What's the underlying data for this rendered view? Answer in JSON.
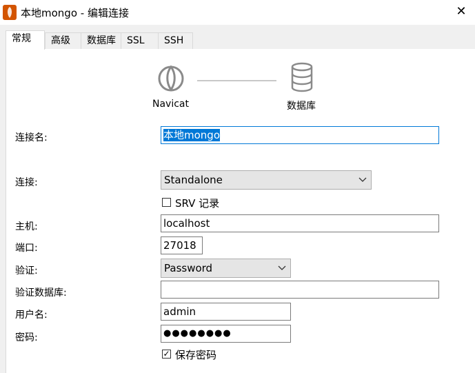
{
  "window": {
    "title": "本地mongo - 编辑连接",
    "close_glyph": "✕"
  },
  "tabs": [
    {
      "label": "常规"
    },
    {
      "label": "高级"
    },
    {
      "label": "数据库"
    },
    {
      "label": "SSL"
    },
    {
      "label": "SSH"
    }
  ],
  "diagram": {
    "left_label": "Navicat",
    "right_label": "数据库"
  },
  "form": {
    "conn_name": {
      "label": "连接名:",
      "value": "本地mongo"
    },
    "connection": {
      "label": "连接:",
      "value": "Standalone"
    },
    "srv": {
      "label": "SRV 记录",
      "checked": false
    },
    "host": {
      "label": "主机:",
      "value": "localhost"
    },
    "port": {
      "label": "端口:",
      "value": "27018"
    },
    "auth": {
      "label": "验证:",
      "value": "Password"
    },
    "auth_db": {
      "label": "验证数据库:",
      "value": ""
    },
    "username": {
      "label": "用户名:",
      "value": "admin"
    },
    "password": {
      "label": "密码:",
      "value": "●●●●●●●●"
    },
    "save_password": {
      "label": "保存密码",
      "checked": true,
      "glyph": "✓"
    }
  },
  "icons": {
    "app": "navicat-app-icon",
    "navicat": "navicat-seal-icon",
    "database": "database-icon",
    "dropdown": "chevron-down-icon"
  }
}
